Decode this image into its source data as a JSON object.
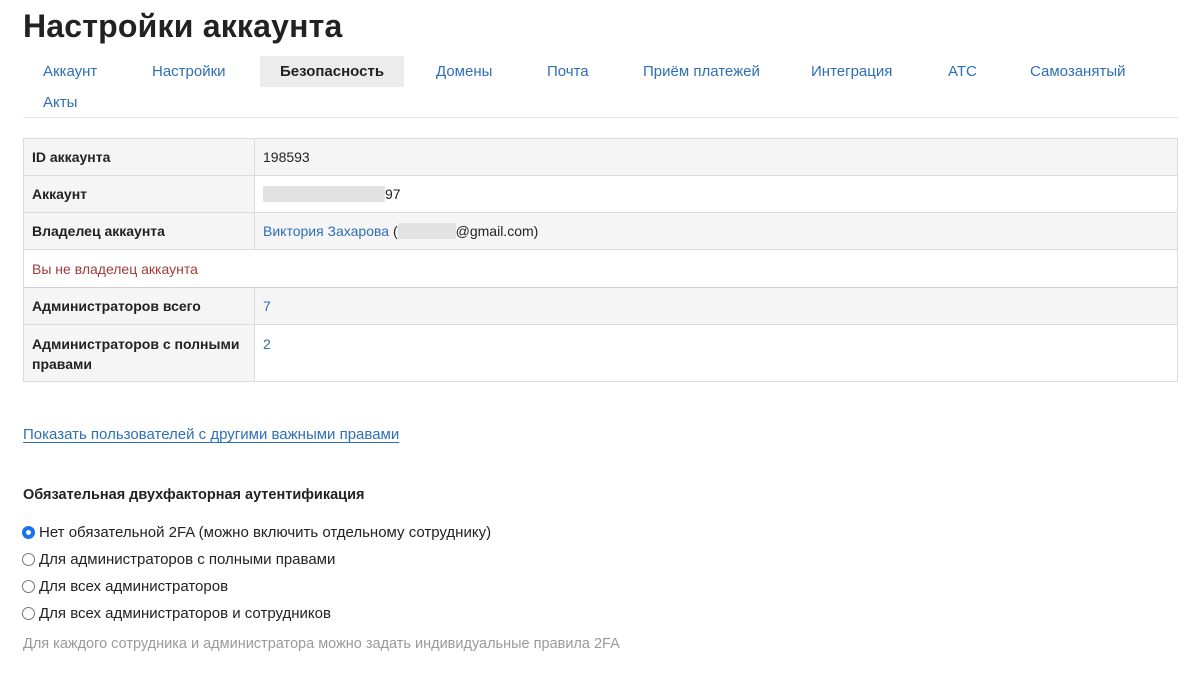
{
  "page_title": "Настройки аккаунта",
  "tabs": [
    {
      "label": "Аккаунт",
      "active": false
    },
    {
      "label": "Настройки",
      "active": false
    },
    {
      "label": "Безопасность",
      "active": true
    },
    {
      "label": "Домены",
      "active": false
    },
    {
      "label": "Почта",
      "active": false
    },
    {
      "label": "Приём платежей",
      "active": false
    },
    {
      "label": "Интеграция",
      "active": false
    },
    {
      "label": "АТС",
      "active": false
    },
    {
      "label": "Самозанятый",
      "active": false
    },
    {
      "label": "Акты",
      "active": false
    }
  ],
  "info": {
    "account_id_label": "ID аккаунта",
    "account_id_value": "198593",
    "account_label": "Аккаунт",
    "account_value_suffix": "97",
    "owner_label": "Владелец аккаунта",
    "owner_name": "Виктория Захарова",
    "owner_email_prefix": " (",
    "owner_email_suffix": "@gmail.com)",
    "not_owner_notice": "Вы не владелец аккаунта",
    "admins_total_label": "Администраторов всего",
    "admins_total_value": "7",
    "admins_full_label": "Администраторов с полными правами",
    "admins_full_value": "2"
  },
  "show_users_link": "Показать пользователей с другими важными правами",
  "twofa": {
    "title": "Обязательная двухфакторная аутентификация",
    "options": [
      {
        "label": "Нет обязательной 2FA (можно включить отдельному сотруднику)",
        "checked": true
      },
      {
        "label": "Для администраторов с полными правами",
        "checked": false
      },
      {
        "label": "Для всех администраторов",
        "checked": false
      },
      {
        "label": "Для всех администраторов и сотрудников",
        "checked": false
      }
    ],
    "hint": "Для каждого сотрудника и администратора можно задать индивидуальные правила 2FA"
  },
  "colors": {
    "link": "#2f6fb5",
    "warning": "#a33a3a",
    "radio_checked": "#1a73e8"
  }
}
